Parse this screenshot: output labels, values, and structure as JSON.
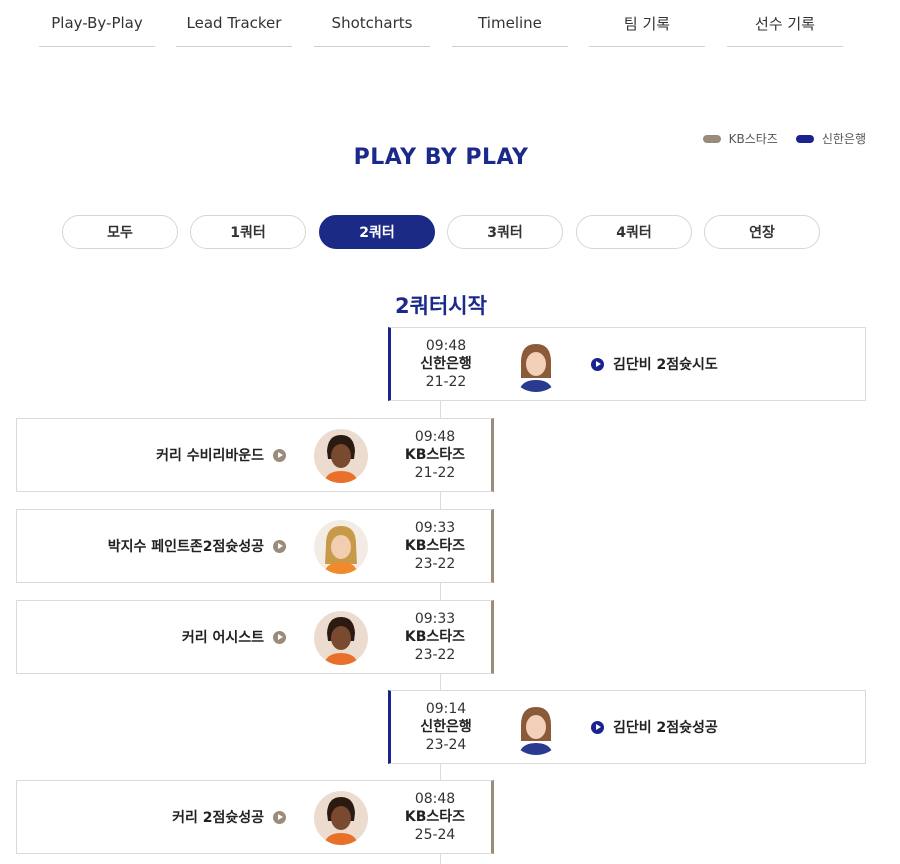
{
  "tabs": [
    {
      "label": "Play-By-Play",
      "active": true
    },
    {
      "label": "Lead Tracker",
      "active": false
    },
    {
      "label": "Shotcharts",
      "active": false
    },
    {
      "label": "Timeline",
      "active": false
    },
    {
      "label": "팀 기록",
      "active": false
    },
    {
      "label": "선수 기록",
      "active": false
    }
  ],
  "legend": {
    "home_team": "KB스타즈",
    "away_team": "신한은행",
    "home_color": "#9b8b7a",
    "away_color": "#1a2290"
  },
  "title": "PLAY BY PLAY",
  "quarters": [
    {
      "label": "모두",
      "active": false
    },
    {
      "label": "1쿼터",
      "active": false
    },
    {
      "label": "2쿼터",
      "active": true
    },
    {
      "label": "3쿼터",
      "active": false
    },
    {
      "label": "4쿼터",
      "active": false
    },
    {
      "label": "연장",
      "active": false
    }
  ],
  "section_title": "2쿼터시작",
  "events": [
    {
      "side": "away",
      "time": "09:48",
      "team": "신한은행",
      "score": "21-22",
      "desc": "김단비 2점슛시도",
      "icon": "player-photo-kim-danbi"
    },
    {
      "side": "home",
      "time": "09:48",
      "team": "KB스타즈",
      "score": "21-22",
      "desc": "커리 수비리바운드",
      "icon": "player-photo-curry"
    },
    {
      "side": "home",
      "time": "09:33",
      "team": "KB스타즈",
      "score": "23-22",
      "desc": "박지수 페인트존2점슛성공",
      "icon": "player-photo-park-jisu"
    },
    {
      "side": "home",
      "time": "09:33",
      "team": "KB스타즈",
      "score": "23-22",
      "desc": "커리 어시스트",
      "icon": "player-photo-curry"
    },
    {
      "side": "away",
      "time": "09:14",
      "team": "신한은행",
      "score": "23-24",
      "desc": "김단비 2점슛성공",
      "icon": "player-photo-kim-danbi"
    },
    {
      "side": "home",
      "time": "08:48",
      "team": "KB스타즈",
      "score": "25-24",
      "desc": "커리 2점슛성공",
      "icon": "player-photo-curry"
    }
  ]
}
